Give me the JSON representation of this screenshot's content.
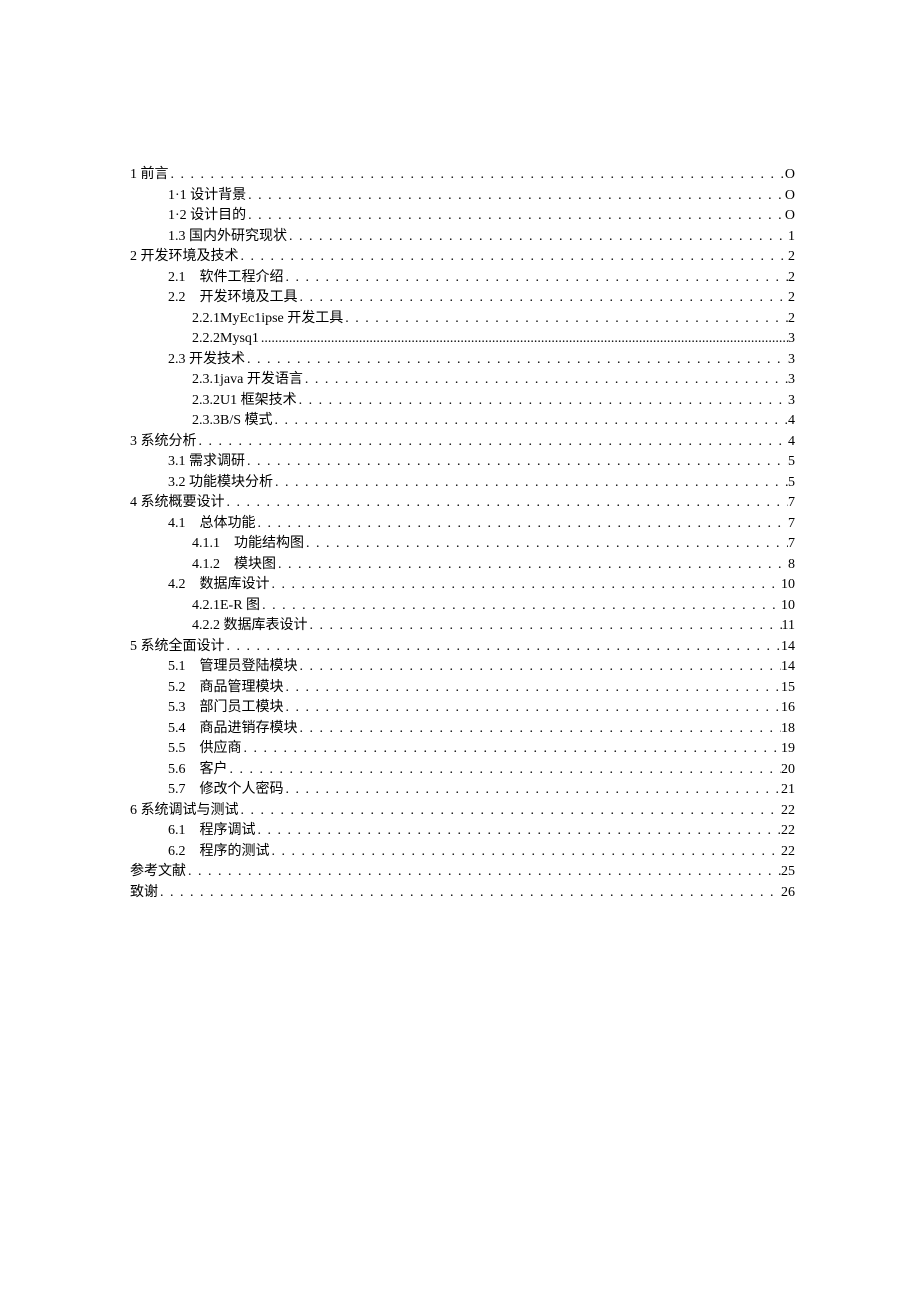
{
  "toc": [
    {
      "label": "1 前言",
      "page": "O",
      "level": 0
    },
    {
      "label": "1·1 设计背景",
      "page": "O",
      "level": 1
    },
    {
      "label": "1·2 设计目的",
      "page": "O",
      "level": 1
    },
    {
      "label": "1.3 国内外研究现状",
      "page": "1",
      "level": 1
    },
    {
      "label": "2 开发环境及技术",
      "page": "2",
      "level": 0
    },
    {
      "label": "2.1　软件工程介绍",
      "page": "2",
      "level": 1
    },
    {
      "label": "2.2　开发环境及工具",
      "page": "2",
      "level": 1
    },
    {
      "label": "2.2.1MyEc1ipse 开发工具",
      "page": "2",
      "level": 2
    },
    {
      "label": "2.2.2Mysq1",
      "page": "3",
      "level": 2,
      "tight": true
    },
    {
      "label": "2.3 开发技术",
      "page": "3",
      "level": 1
    },
    {
      "label": "2.3.1java 开发语言",
      "page": "3",
      "level": 2
    },
    {
      "label": "2.3.2U1 框架技术",
      "page": "3",
      "level": 2
    },
    {
      "label": "2.3.3B/S 模式",
      "page": "4",
      "level": 2
    },
    {
      "label": "3 系统分析",
      "page": "4",
      "level": 0
    },
    {
      "label": "3.1 需求调研",
      "page": "5",
      "level": 1
    },
    {
      "label": "3.2 功能模块分析",
      "page": "5",
      "level": 1
    },
    {
      "label": "4 系统概要设计",
      "page": "7",
      "level": 0
    },
    {
      "label": "4.1　总体功能",
      "page": "7",
      "level": 1
    },
    {
      "label": "4.1.1　功能结构图",
      "page": "7",
      "level": 2
    },
    {
      "label": "4.1.2　模块图",
      "page": "8",
      "level": 2
    },
    {
      "label": "4.2　数据库设计",
      "page": "10",
      "level": 1
    },
    {
      "label": "4.2.1E-R 图",
      "page": "10",
      "level": 2
    },
    {
      "label": "4.2.2 数据库表设计",
      "page": "11",
      "level": 2
    },
    {
      "label": "5 系统全面设计",
      "page": "14",
      "level": 0
    },
    {
      "label": "5.1　管理员登陆模块",
      "page": "14",
      "level": 1
    },
    {
      "label": "5.2　商品管理模块",
      "page": "15",
      "level": 1
    },
    {
      "label": "5.3　部门员工模块",
      "page": "16",
      "level": 1
    },
    {
      "label": "5.4　商品进销存模块",
      "page": "18",
      "level": 1
    },
    {
      "label": "5.5　供应商",
      "page": "19",
      "level": 1
    },
    {
      "label": "5.6　客户",
      "page": "20",
      "level": 1
    },
    {
      "label": "5.7　修改个人密码",
      "page": "21",
      "level": 1
    },
    {
      "label": "6 系统调试与测试",
      "page": "22",
      "level": 0
    },
    {
      "label": "6.1　程序调试",
      "page": "22",
      "level": 1
    },
    {
      "label": "6.2　程序的测试",
      "page": "22",
      "level": 1
    },
    {
      "label": "参考文献",
      "page": "25",
      "level": 0
    },
    {
      "label": "致谢",
      "page": "26",
      "level": 0
    }
  ]
}
